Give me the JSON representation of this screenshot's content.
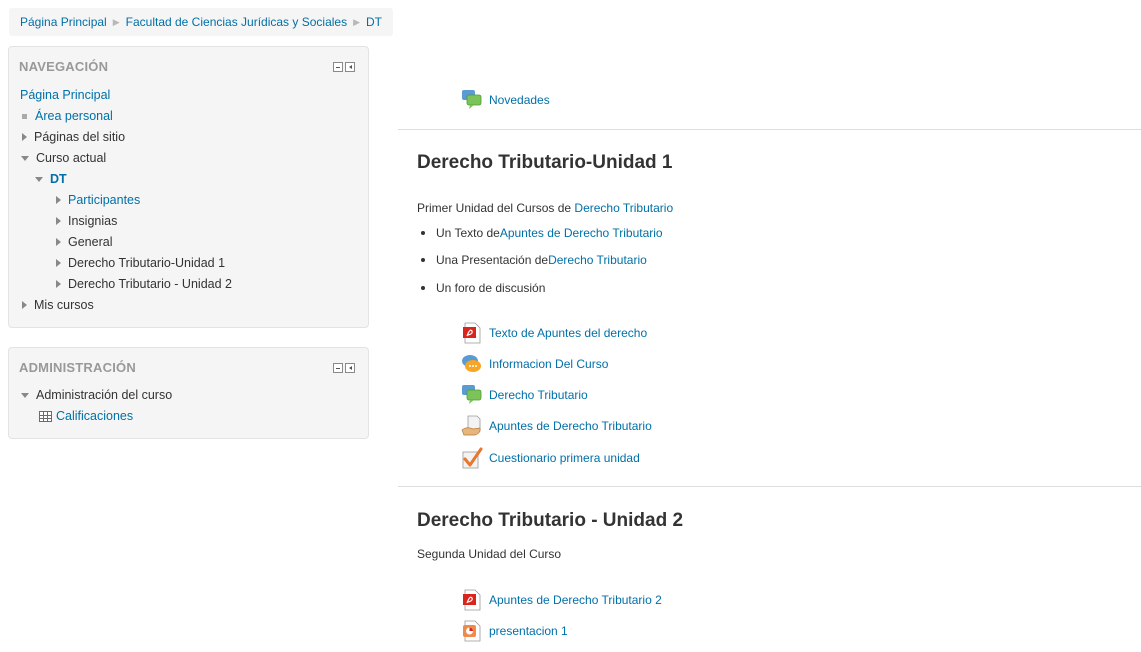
{
  "breadcrumb": [
    "Página Principal",
    "Facultad de Ciencias Jurídicas y Sociales",
    "DT"
  ],
  "nav_block": {
    "title": "NAVEGACIÓN",
    "home": "Página Principal",
    "area_personal": "Área personal",
    "paginas_sitio": "Páginas del sitio",
    "curso_actual": "Curso actual",
    "course": "DT",
    "course_items": [
      "Participantes",
      "Insignias",
      "General",
      "Derecho Tributario-Unidad 1",
      "Derecho Tributario - Unidad 2"
    ],
    "mis_cursos": "Mis cursos"
  },
  "admin_block": {
    "title": "ADMINISTRACIÓN",
    "course_admin": "Administración del curso",
    "grades": "Calificaciones"
  },
  "main": {
    "news": "Novedades",
    "unit1": {
      "title": "Derecho Tributario-Unidad 1",
      "summary_prefix": "Primer Unidad del Cursos de ",
      "summary_link": "Derecho Tributario",
      "bullets": [
        {
          "prefix": "Un Texto de ",
          "link": "Apuntes de Derecho Tributario"
        },
        {
          "prefix": "Una Presentación de ",
          "link": "Derecho Tributario"
        },
        {
          "prefix": "Un foro de discusión",
          "link": ""
        }
      ],
      "activities": [
        {
          "label": "Texto de Apuntes del derecho",
          "icon": "pdf-icon"
        },
        {
          "label": "Informacion Del Curso",
          "icon": "chat-icon"
        },
        {
          "label": "Derecho Tributario",
          "icon": "forum-icon"
        },
        {
          "label": "Apuntes de Derecho Tributario",
          "icon": "assignment-icon"
        },
        {
          "label": "Cuestionario primera unidad",
          "icon": "quiz-icon"
        }
      ]
    },
    "unit2": {
      "title": "Derecho Tributario - Unidad 2",
      "summary": "Segunda Unidad del Curso",
      "activities": [
        {
          "label": "Apuntes de Derecho Tributario 2",
          "icon": "pdf-icon"
        },
        {
          "label": "presentacion 1",
          "icon": "powerpoint-icon"
        }
      ]
    }
  },
  "colors": {
    "link": "#0070a8",
    "block_bg": "#f5f5f5",
    "block_title": "#999999"
  }
}
